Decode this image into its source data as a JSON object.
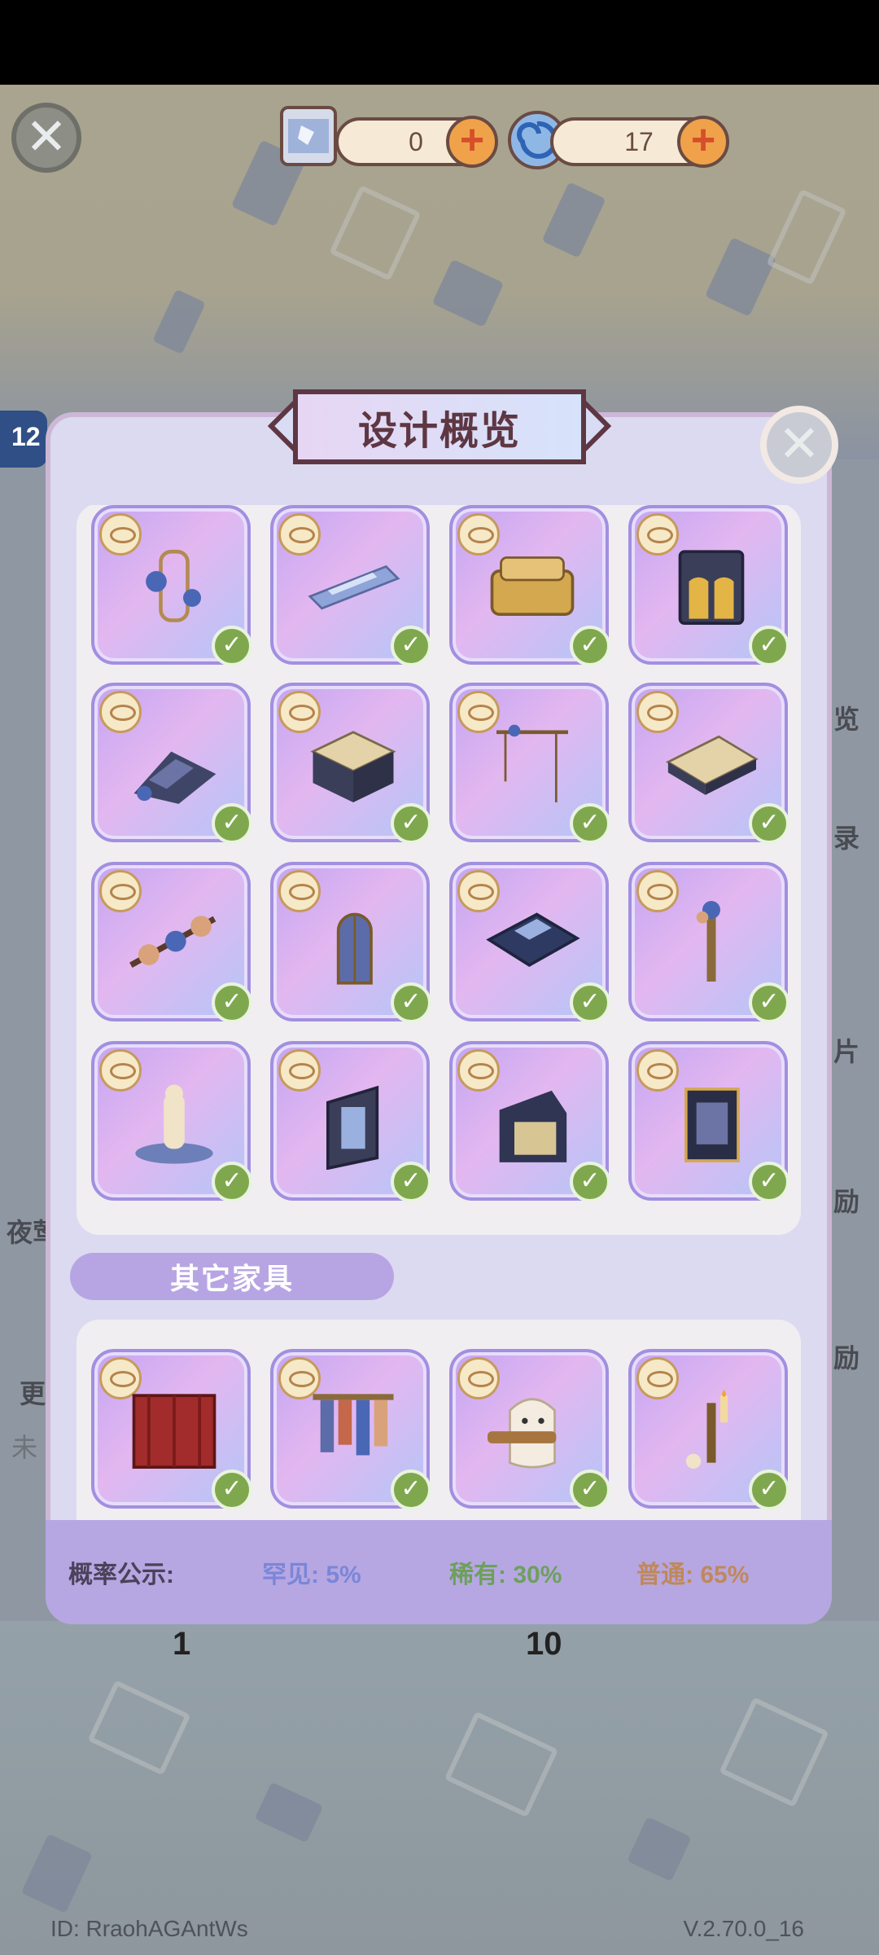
{
  "top_bar": {
    "scroll_count": "0",
    "swirl_count": "17"
  },
  "modal": {
    "title": "设计概览",
    "section_other": "其它家具"
  },
  "probability": {
    "label": "概率公示:",
    "rare": "罕见: 5%",
    "uncommon": "稀有: 30%",
    "common": "普通: 65%",
    "colors": {
      "rare": "#7a86d8",
      "uncommon": "#6e9f5c",
      "common": "#c0885a",
      "label": "#4b4159"
    }
  },
  "background": {
    "left_label_a": "夜莺",
    "left_label_b": "更",
    "left_label_c": "未",
    "right_label_a": "览",
    "right_label_b": "录",
    "right_label_c": "片",
    "right_label_d": "励",
    "right_label_e": "励",
    "bottom_count_a": "1",
    "bottom_count_b": "10",
    "badge_num": "12"
  },
  "footer": {
    "id": "ID: RraohAGAntWs",
    "version": "V.2.70.0_16"
  },
  "furniture_items": [
    "birdcage-lamp",
    "glass-runway",
    "golden-sofa",
    "gothic-cabinet",
    "rose-staircase",
    "marble-gothic-counter",
    "flower-swing",
    "marble-bed",
    "rose-garland",
    "stained-glass-window",
    "checkered-stage",
    "rose-lamp-post",
    "angel-fountain",
    "gothic-mirror-wardrobe",
    "gothic-alcove",
    "gothic-booth"
  ],
  "other_items": [
    "red-curtain",
    "clothes-rack",
    "ghost-cat-waiter",
    "candle-wall-sconce"
  ]
}
